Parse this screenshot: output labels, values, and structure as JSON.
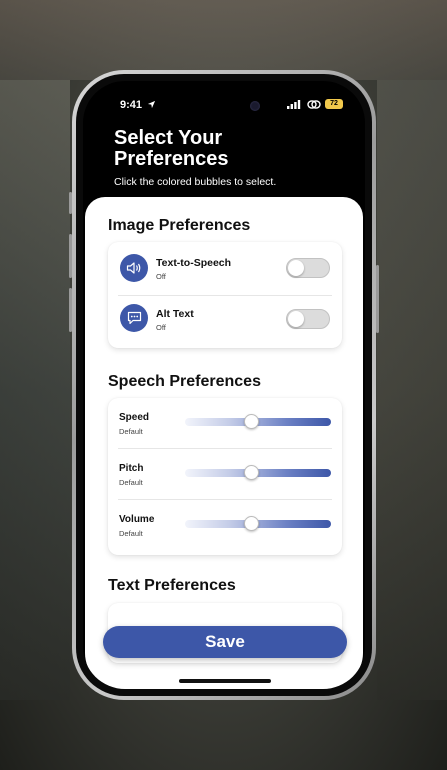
{
  "status_bar": {
    "time": "9:41",
    "battery": "72",
    "icons": [
      "location-arrow-icon",
      "cellular-signal-icon",
      "link-icon",
      "battery-icon"
    ]
  },
  "header": {
    "title": "Select Your Preferences",
    "subtitle": "Click the colored bubbles to select."
  },
  "image_prefs": {
    "title": "Image Preferences",
    "items": [
      {
        "label": "Text-to-Speech",
        "status": "Off",
        "icon": "speaker-icon",
        "on": false
      },
      {
        "label": "Alt Text",
        "status": "Off",
        "icon": "chat-bubble-icon",
        "on": false
      }
    ]
  },
  "speech_prefs": {
    "title": "Speech Preferences",
    "items": [
      {
        "label": "Speed",
        "status": "Default",
        "value": 0.45
      },
      {
        "label": "Pitch",
        "status": "Default",
        "value": 0.45
      },
      {
        "label": "Volume",
        "status": "Default",
        "value": 0.45
      }
    ]
  },
  "text_prefs": {
    "title": "Text Preferences"
  },
  "actions": {
    "save_label": "Save"
  },
  "colors": {
    "accent": "#3d57a8",
    "header_bg": "#000000",
    "card_bg": "#ffffff",
    "toggle_off": "#dcdcdc"
  }
}
